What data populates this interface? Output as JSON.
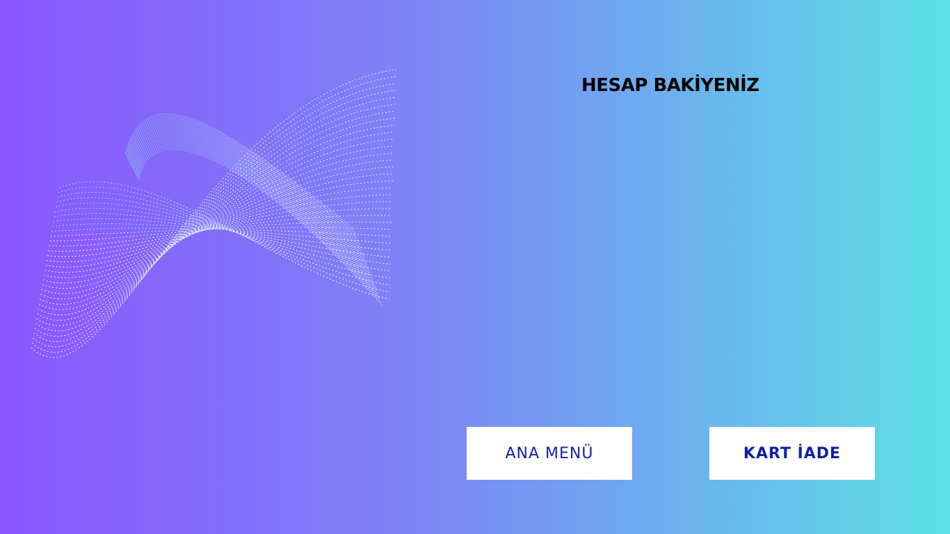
{
  "screen": {
    "title": "HESAP BAKİYENİZ",
    "background_gradient": [
      "#8b55ff",
      "#7c86f5",
      "#6ab7ec",
      "#5de0e6"
    ]
  },
  "decoration": {
    "icon": "wave-mesh-graphic",
    "colors": [
      "#ffffff",
      "#7de3f0"
    ]
  },
  "buttons": {
    "main_menu_label": "ANA MENÜ",
    "card_return_label": "KART İADE",
    "text_color": "#0f1fa8",
    "bg_color": "#ffffff"
  }
}
